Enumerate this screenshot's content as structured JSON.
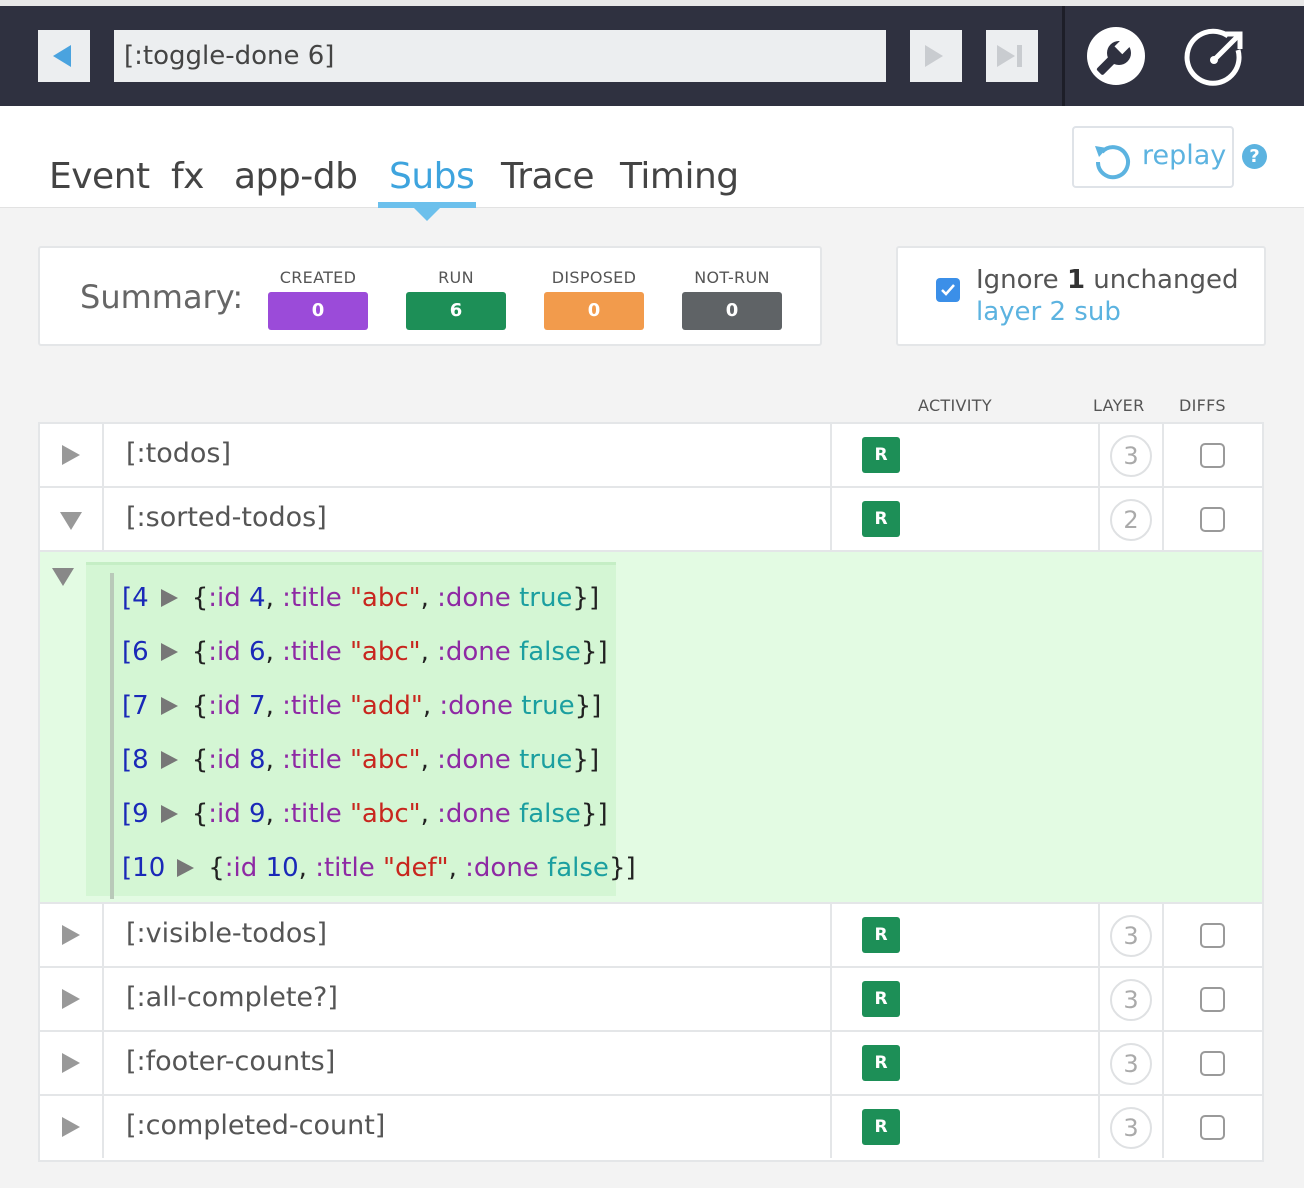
{
  "topbar": {
    "event_value": "[:toggle-done 6]",
    "icons": [
      "back-arrow-icon",
      "forward-arrow-icon",
      "skip-to-end-icon",
      "settings-wrench-icon",
      "popout-icon"
    ]
  },
  "tabs": [
    {
      "label": "Event",
      "active": false
    },
    {
      "label": "fx",
      "active": false
    },
    {
      "label": "app-db",
      "active": false
    },
    {
      "label": "Subs",
      "active": true
    },
    {
      "label": "Trace",
      "active": false
    },
    {
      "label": "Timing",
      "active": false
    }
  ],
  "replay": {
    "label": "replay"
  },
  "help": {
    "label": "?"
  },
  "summary": {
    "label": "Summary:",
    "stats": [
      {
        "title": "CREATED",
        "value": "0",
        "color": "#9b4bd9"
      },
      {
        "title": "RUN",
        "value": "6",
        "color": "#1d8f57"
      },
      {
        "title": "DISPOSED",
        "value": "0",
        "color": "#f29b4c"
      },
      {
        "title": "NOT-RUN",
        "value": "0",
        "color": "#5f6366"
      }
    ]
  },
  "ignore": {
    "checked": true,
    "text_prefix": "Ignore",
    "count": "1",
    "text_suffix": "unchanged",
    "link": "layer 2 sub"
  },
  "columns": {
    "activity": "ACTIVITY",
    "layer": "LAYER",
    "diffs": "DIFFS"
  },
  "rows": [
    {
      "name": "[:todos]",
      "activity": "R",
      "layer": "3",
      "expanded": false
    },
    {
      "name": "[:sorted-todos]",
      "activity": "R",
      "layer": "2",
      "expanded": true
    },
    {
      "name": "[:visible-todos]",
      "activity": "R",
      "layer": "3",
      "expanded": false
    },
    {
      "name": "[:all-complete?]",
      "activity": "R",
      "layer": "3",
      "expanded": false
    },
    {
      "name": "[:footer-counts]",
      "activity": "R",
      "layer": "3",
      "expanded": false
    },
    {
      "name": "[:completed-count]",
      "activity": "R",
      "layer": "3",
      "expanded": false
    }
  ],
  "expanded_data": [
    {
      "index": "4",
      "id": "4",
      "title": "\"abc\"",
      "done": "true"
    },
    {
      "index": "6",
      "id": "6",
      "title": "\"abc\"",
      "done": "false"
    },
    {
      "index": "7",
      "id": "7",
      "title": "\"add\"",
      "done": "true"
    },
    {
      "index": "8",
      "id": "8",
      "title": "\"abc\"",
      "done": "true"
    },
    {
      "index": "9",
      "id": "9",
      "title": "\"abc\"",
      "done": "false"
    },
    {
      "index": "10",
      "id": "10",
      "title": "\"def\"",
      "done": "false"
    }
  ],
  "edn_tokens": {
    "open_bracket": "[",
    "open_brace": "{",
    "kw_id": ":id",
    "kw_title": ":title",
    "kw_done": ":done",
    "close": "}]",
    "comma": ","
  }
}
